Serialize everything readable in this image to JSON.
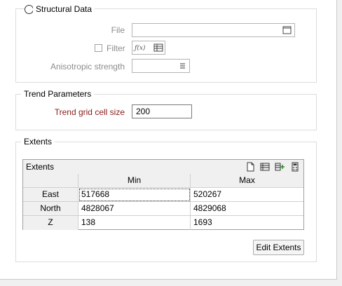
{
  "structural": {
    "title": "Structural Data",
    "file_label": "File",
    "file_value": "",
    "filter_label": "Filter",
    "anisotropic_label": "Anisotropic strength",
    "anisotropic_value": ""
  },
  "trend": {
    "title": "Trend Parameters",
    "cell_size_label": "Trend grid cell size",
    "cell_size_value": "200"
  },
  "extents": {
    "group_title": "Extents",
    "grid_title": "Extents",
    "columns": [
      "Min",
      "Max"
    ],
    "rows": [
      {
        "label": "East",
        "min": "517668",
        "max": "520267"
      },
      {
        "label": "North",
        "min": "4828067",
        "max": "4829068"
      },
      {
        "label": "Z",
        "min": "138",
        "max": "1693"
      }
    ],
    "edit_button": "Edit Extents"
  },
  "icons": {
    "function": "ƒ(x)"
  },
  "colors": {
    "required_label": "#8b1a1a",
    "disabled_label": "#8c8c8c"
  }
}
